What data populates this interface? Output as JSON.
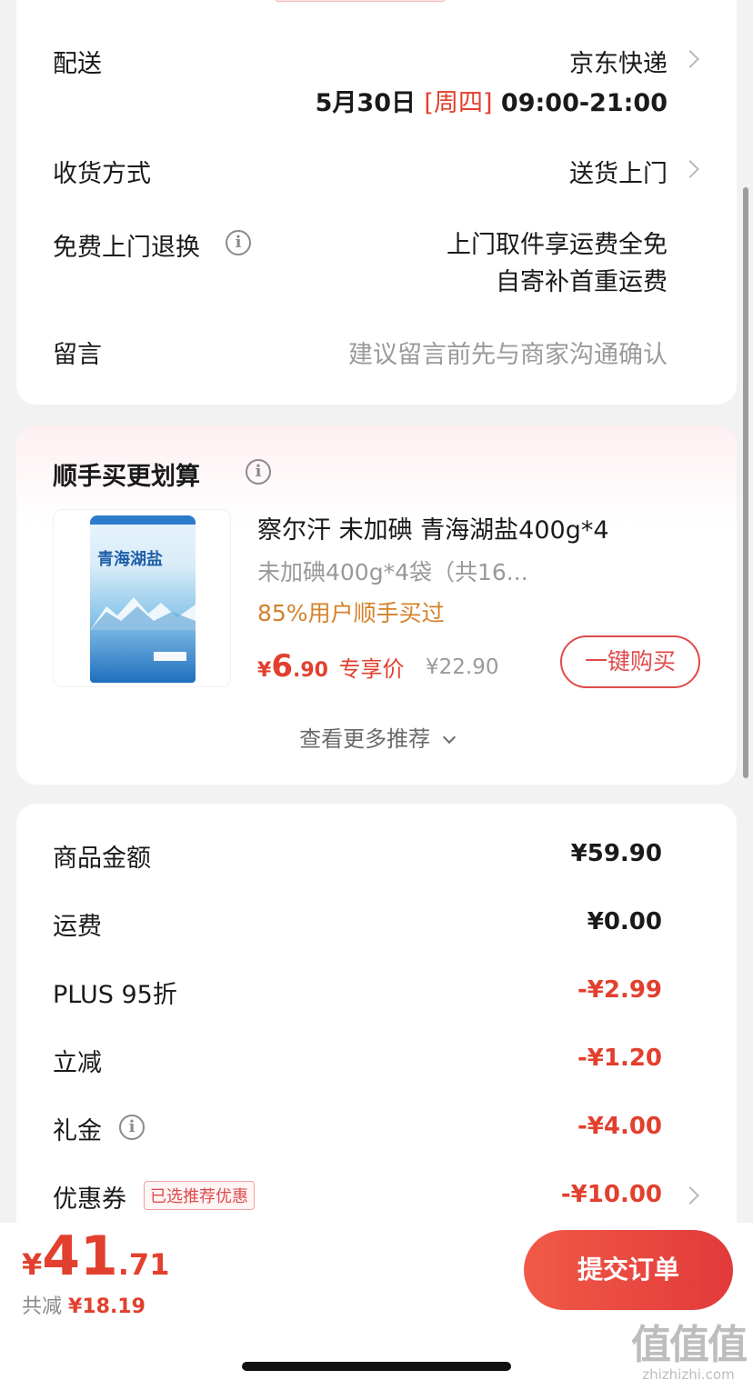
{
  "delivery": {
    "label": "配送",
    "carrier": "京东快递",
    "date": "5月30日",
    "weekday": "[周四]",
    "time": "09:00-21:00"
  },
  "receive_method": {
    "label": "收货方式",
    "value": "送货上门"
  },
  "free_return": {
    "label": "免费上门退换",
    "line1": "上门取件享运费全免",
    "line2": "自寄补首重运费"
  },
  "message": {
    "label": "留言",
    "placeholder": "建议留言前先与商家沟通确认"
  },
  "addon": {
    "title": "顺手买更划算",
    "product": {
      "name": "察尔汗 未加碘 青海湖盐400g*4",
      "spec": "未加碘400g*4袋（共16...",
      "bought": "85%用户顺手买过",
      "price_symbol": "¥",
      "price_int": "6",
      "price_dec": ".90",
      "price_tag": "专享价",
      "orig_price": "¥22.90",
      "buy_button": "一键购买",
      "image_text": "青海湖盐"
    },
    "more": "查看更多推荐"
  },
  "summary": [
    {
      "label": "商品金额",
      "value": "¥59.90",
      "red": false
    },
    {
      "label": "运费",
      "value": "¥0.00",
      "red": false
    },
    {
      "label": "PLUS 95折",
      "value": "-¥2.99",
      "red": true
    },
    {
      "label": "立减",
      "value": "-¥1.20",
      "red": true
    },
    {
      "label": "礼金",
      "value": "-¥4.00",
      "red": true
    },
    {
      "label": "优惠券",
      "value": "-¥10.00",
      "red": true
    }
  ],
  "coupon_tag": "已选推荐优惠",
  "footer": {
    "symbol": "¥",
    "total_int": "41",
    "total_dec": ".71",
    "saved_label": "共减",
    "saved_value": "¥18.19",
    "submit": "提交订单"
  },
  "watermark": {
    "big": "值值值",
    "url": "zhizhizhi.com"
  },
  "colors": {
    "accent": "#e2402e",
    "orange": "#d4822a",
    "bg": "#f2f2f2"
  }
}
